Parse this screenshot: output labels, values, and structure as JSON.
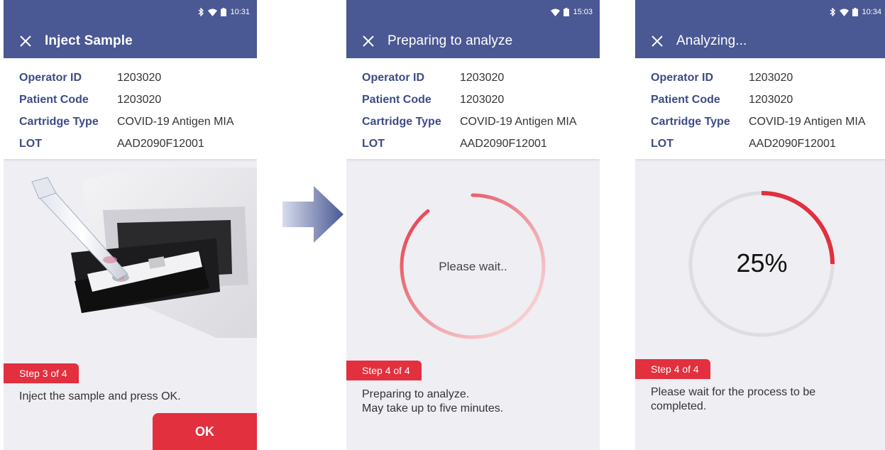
{
  "screens": [
    {
      "status_time": "10:31",
      "title": "Inject Sample",
      "info": [
        {
          "label": "Operator ID",
          "value": "1203020"
        },
        {
          "label": "Patient Code",
          "value": "1203020"
        },
        {
          "label": "Cartridge Type",
          "value": "COVID-19 Antigen MIA"
        },
        {
          "label": "LOT",
          "value": "AAD2090F12001"
        }
      ],
      "step": "Step 3 of 4",
      "instruction": "Inject the sample and press OK.",
      "ok_label": "OK"
    },
    {
      "status_time": "15:03",
      "title": "Preparing to analyze",
      "info": [
        {
          "label": "Operator ID",
          "value": "1203020"
        },
        {
          "label": "Patient Code",
          "value": "1203020"
        },
        {
          "label": "Cartridge Type",
          "value": "COVID-19 Antigen MIA"
        },
        {
          "label": "LOT",
          "value": "AAD2090F12001"
        }
      ],
      "spinner_text": "Please wait..",
      "step": "Step 4 of 4",
      "instruction_line1": "Preparing to analyze.",
      "instruction_line2": "May take up to five minutes."
    },
    {
      "status_time": "10:34",
      "title": "Analyzing...",
      "info": [
        {
          "label": "Operator ID",
          "value": "1203020"
        },
        {
          "label": "Patient Code",
          "value": "1203020"
        },
        {
          "label": "Cartridge Type",
          "value": "COVID-19 Antigen MIA"
        },
        {
          "label": "LOT",
          "value": "AAD2090F12001"
        }
      ],
      "progress_label": "25%",
      "progress_fraction": 0.25,
      "step": "Step 4 of 4",
      "instruction_line1": "Please wait for the process to be",
      "instruction_line2": "completed."
    }
  ],
  "colors": {
    "header": "#4a5893",
    "accent": "#e2303e",
    "label": "#3d4b87",
    "background": "#eeeef3"
  },
  "icons": [
    "bluetooth-icon",
    "wifi-icon",
    "battery-icon",
    "close-icon",
    "next-arrow-icon"
  ]
}
